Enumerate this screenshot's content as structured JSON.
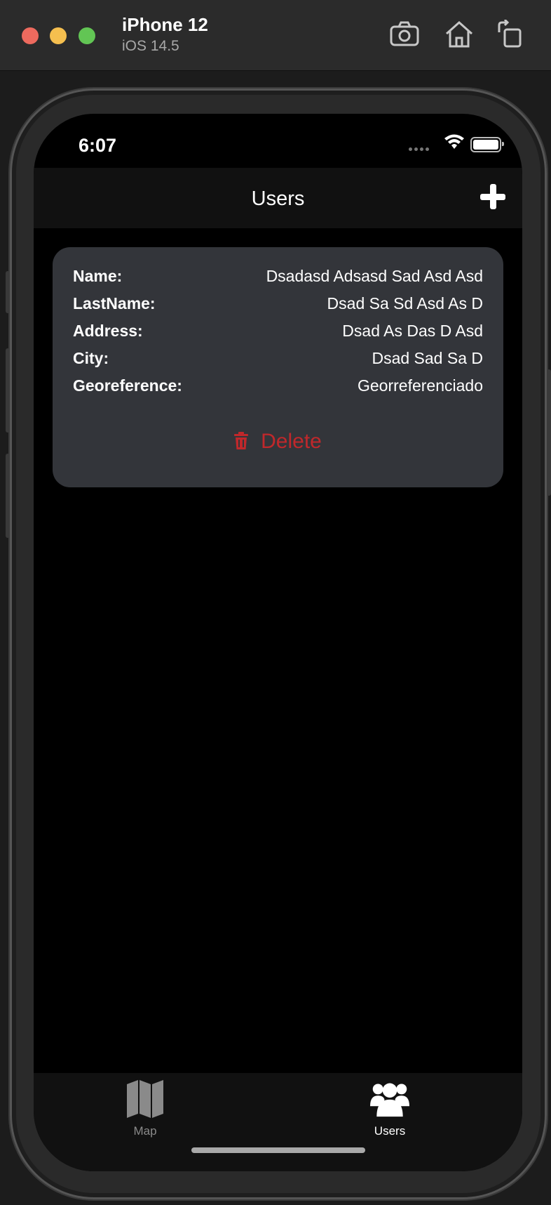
{
  "window": {
    "device_name": "iPhone 12",
    "device_os": "iOS 14.5",
    "icons": [
      "screenshot-icon",
      "home-icon",
      "rotate-icon"
    ]
  },
  "status_bar": {
    "time": "6:07"
  },
  "nav": {
    "title": "Users",
    "add_icon": "plus-icon"
  },
  "user_card": {
    "rows": [
      {
        "label": "Name:",
        "value": "Dsadasd Adsasd Sad Asd Asd"
      },
      {
        "label": "LastName:",
        "value": "Dsad Sa Sd Asd As D"
      },
      {
        "label": "Address:",
        "value": "Dsad As Das D Asd"
      },
      {
        "label": "City:",
        "value": "Dsad Sad Sa D"
      },
      {
        "label": "Georeference:",
        "value": "Georreferenciado"
      }
    ],
    "delete_label": "Delete",
    "delete_color": "#c0282b"
  },
  "tabs": [
    {
      "label": "Map",
      "icon": "map-icon",
      "active": false
    },
    {
      "label": "Users",
      "icon": "users-icon",
      "active": true
    }
  ],
  "colors": {
    "card_bg": "#33353a",
    "bar_bg": "#111111",
    "active_tab": "#ffffff",
    "inactive_tab": "#8a8a8a"
  }
}
